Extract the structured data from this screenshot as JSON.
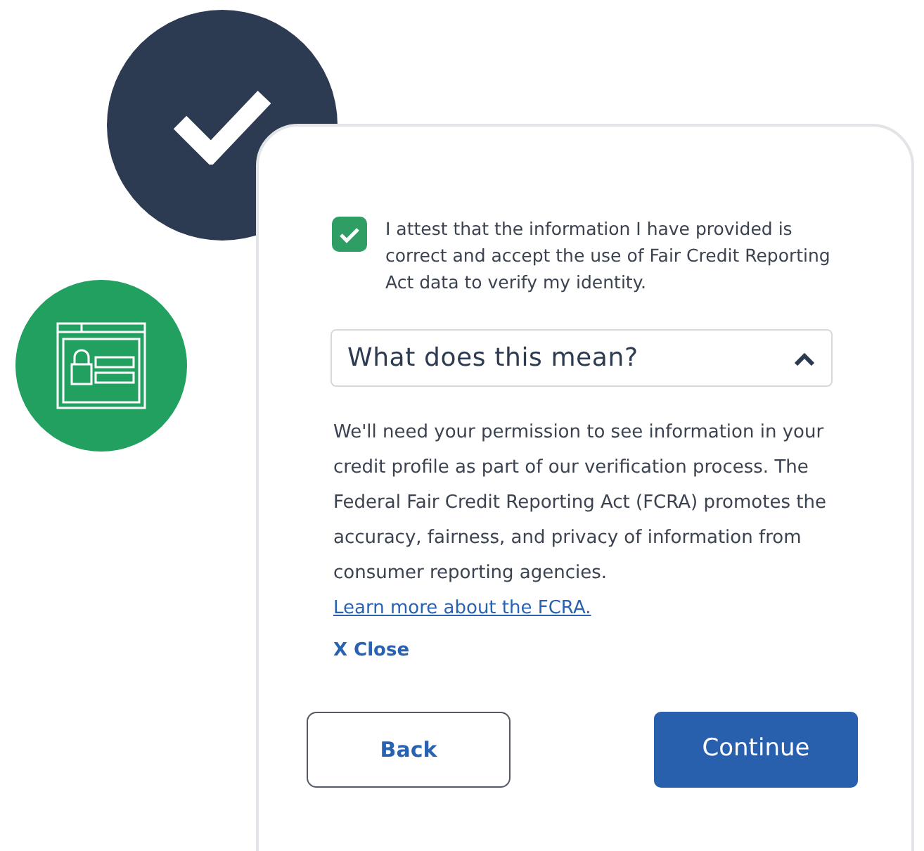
{
  "consent": {
    "checked": true,
    "text": "I attest that the information I have provided is correct and accept the use of Fair Credit Reporting Act data to verify my identity."
  },
  "accordion": {
    "title": "What does this mean?",
    "expanded": true,
    "body": "We'll need your permission to see information in your credit profile as part of our verification process. The Federal Fair Credit Reporting Act (FCRA) promotes the accuracy, fairness, and privacy of information from consumer reporting agencies.",
    "link": "Learn more about the FCRA.",
    "close": "X Close"
  },
  "buttons": [
    {
      "label": "Back",
      "kind": "secondary"
    },
    {
      "label": "Continue",
      "kind": "primary"
    }
  ]
}
